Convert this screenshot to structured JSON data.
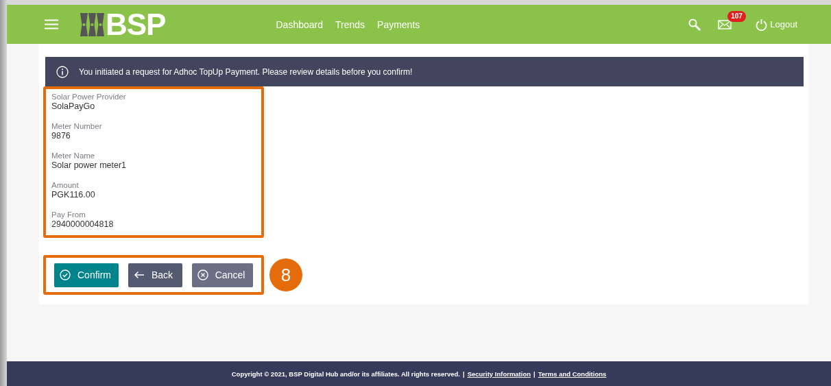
{
  "header": {
    "logo": "BSP",
    "nav": [
      "Dashboard",
      "Trends",
      "Payments"
    ],
    "mail_badge": "107",
    "logout": "Logout"
  },
  "alert": {
    "message": "You initiated a request for Adhoc TopUp Payment. Please review details before you confirm!"
  },
  "details": [
    {
      "label": "Solar Power Provider",
      "value": "SolaPayGo"
    },
    {
      "label": "Meter Number",
      "value": "9876"
    },
    {
      "label": "Meter Name",
      "value": "Solar power meter1"
    },
    {
      "label": "Amount",
      "value": "PGK116.00"
    },
    {
      "label": "Pay From",
      "value": "2940000004818"
    }
  ],
  "buttons": [
    {
      "kind": "confirm",
      "label": "Confirm"
    },
    {
      "kind": "back",
      "label": "Back"
    },
    {
      "kind": "cancel",
      "label": "Cancel"
    }
  ],
  "step_badge": "8",
  "footer": {
    "copyright": "Copyright © 2021, BSP Digital Hub and/or its affiliates. All rights reserved.",
    "separator": "|",
    "links": [
      "Security Information",
      "Terms and Conditions"
    ]
  }
}
